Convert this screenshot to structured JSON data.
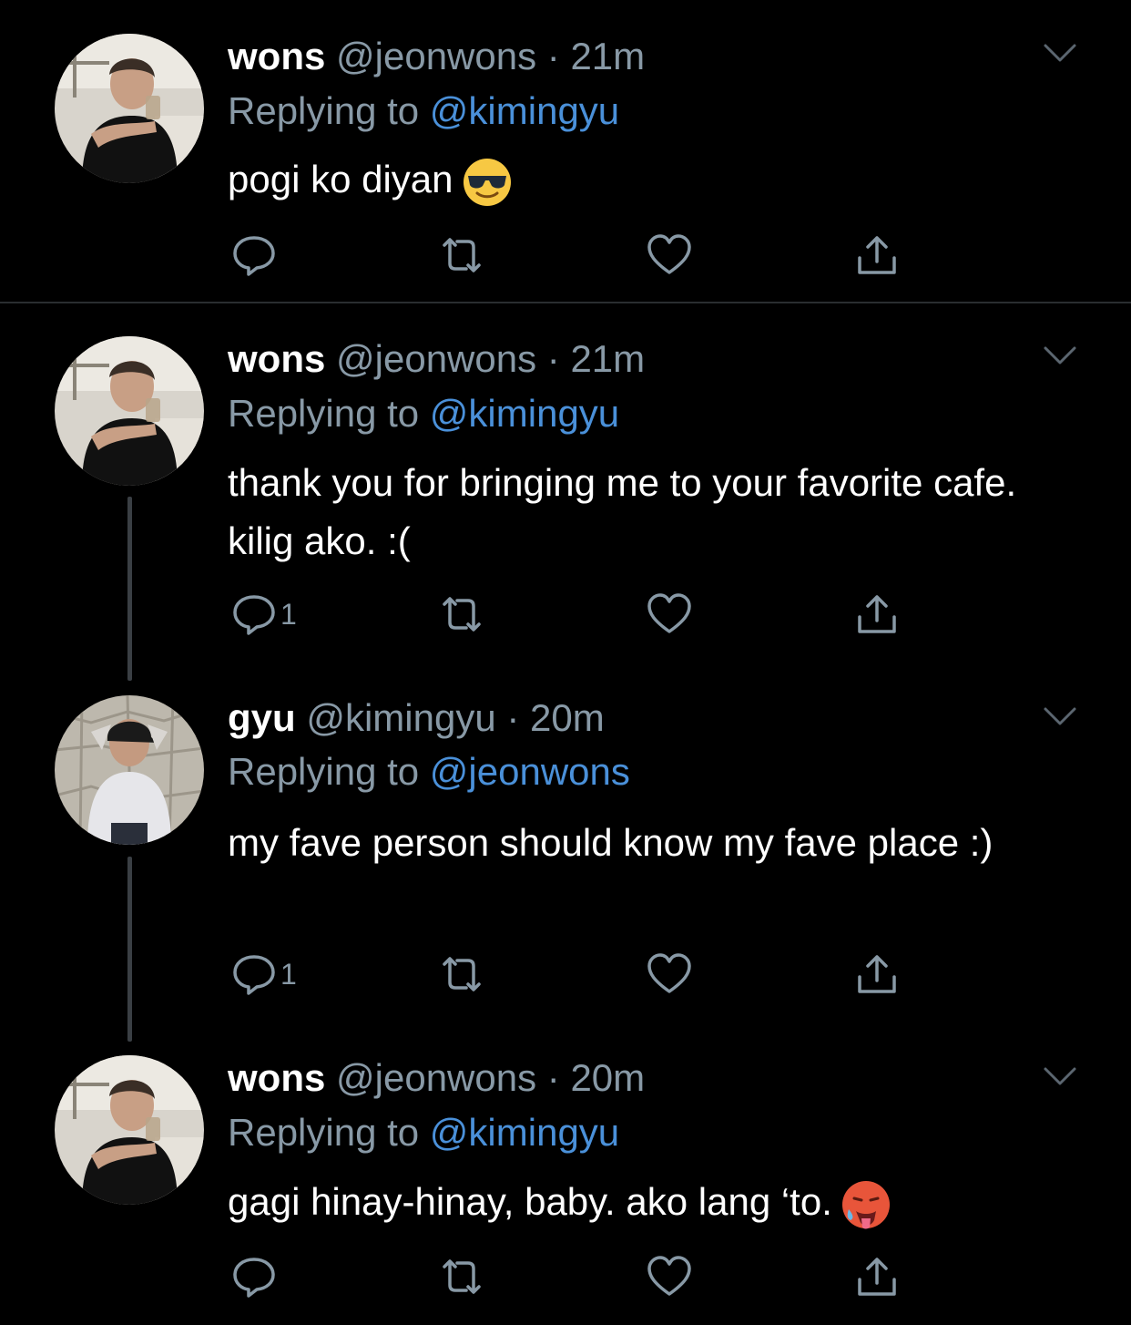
{
  "tweets": [
    {
      "name": "wons",
      "handle": "@jeonwons",
      "dot": "·",
      "time": "21m",
      "reply_prefix": "Replying to ",
      "reply_to": "@kimingyu",
      "text": "pogi ko diyan",
      "emoji": "smiling-face-with-sunglasses",
      "reply_count": ""
    },
    {
      "name": "wons",
      "handle": "@jeonwons",
      "dot": "·",
      "time": "21m",
      "reply_prefix": "Replying to ",
      "reply_to": "@kimingyu",
      "text": "thank you for bringing me to your favorite cafe. kilig ako. :(",
      "reply_count": "1"
    },
    {
      "name": "gyu",
      "handle": "@kimingyu",
      "dot": "·",
      "time": "20m",
      "reply_prefix": "Replying to ",
      "reply_to": "@jeonwons",
      "text": "my fave person should know my fave place :)",
      "reply_count": "1"
    },
    {
      "name": "wons",
      "handle": "@jeonwons",
      "dot": "·",
      "time": "20m",
      "reply_prefix": "Replying to ",
      "reply_to": "@kimingyu",
      "text": "gagi hinay-hinay, baby. ako lang ‘to.",
      "emoji": "hot-face",
      "reply_count": ""
    }
  ],
  "icons": {
    "reply": "reply-icon",
    "retweet": "retweet-icon",
    "like": "heart-icon",
    "share": "share-icon",
    "more": "chevron-down-icon"
  },
  "colors": {
    "background": "#000000",
    "secondary_text": "#8899a6",
    "mention": "#4a90d9",
    "icon": "#8899a6"
  }
}
